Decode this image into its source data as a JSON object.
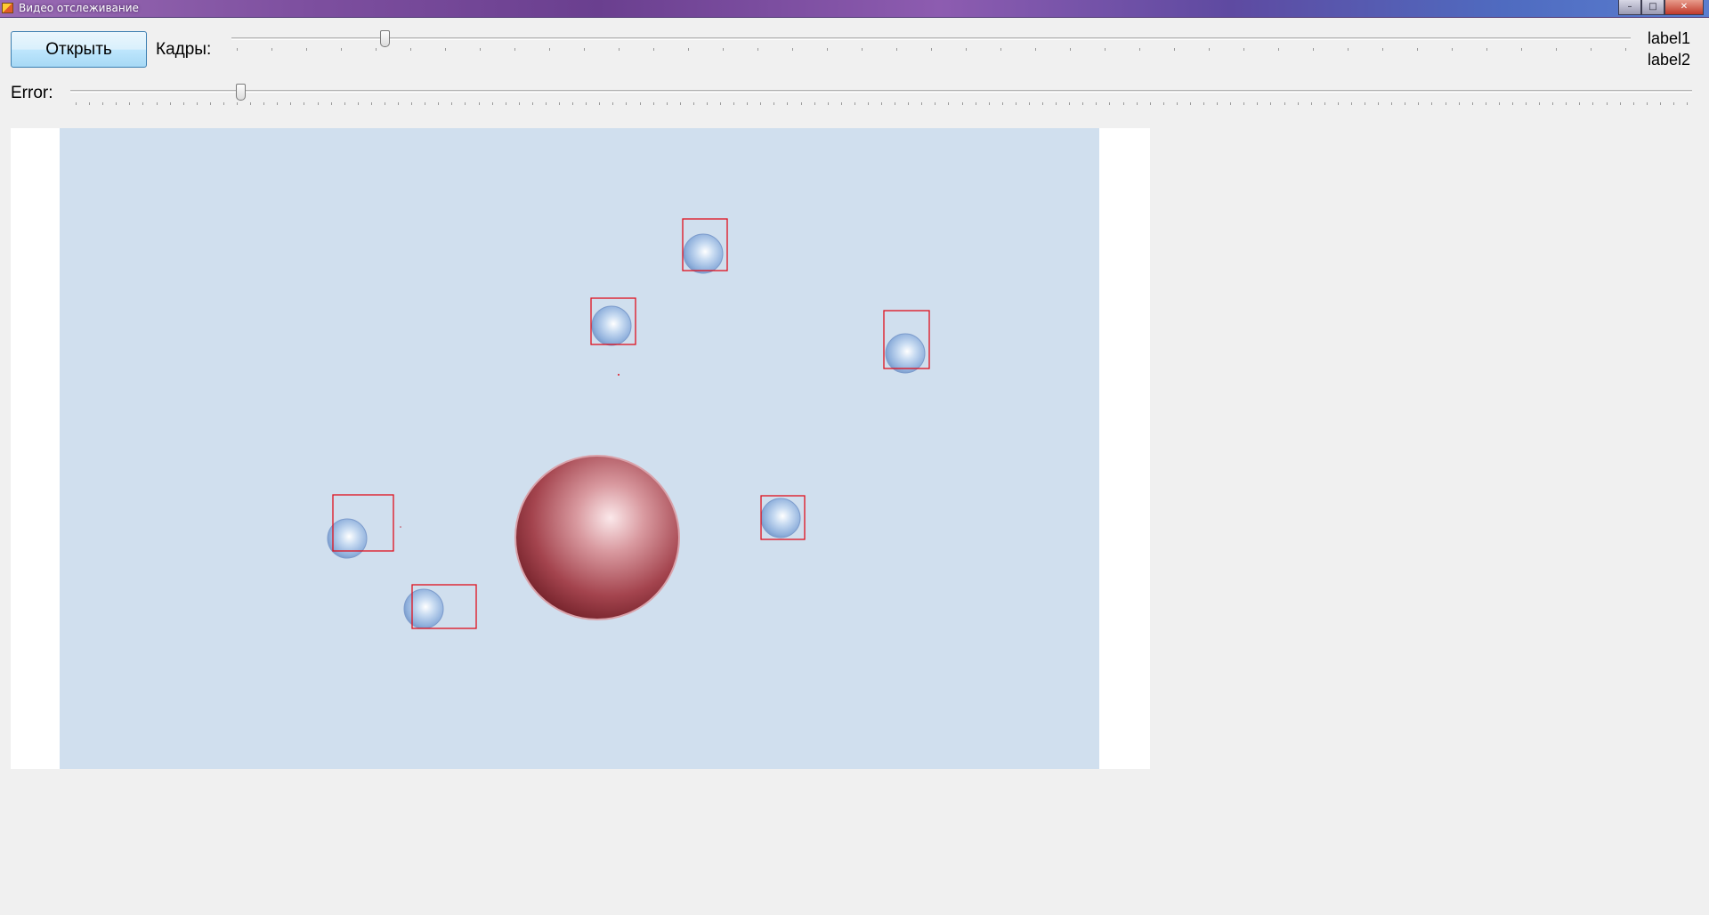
{
  "window": {
    "title": "Видео отслеживание",
    "buttons": {
      "minimize": "–",
      "maximize": "□",
      "close": "✕"
    }
  },
  "toolbar": {
    "open_button": "Открыть",
    "frames_label": "Кадры:",
    "error_label": "Error:",
    "label1": "label1",
    "label2": "label2"
  },
  "sliders": {
    "frames_value_fraction": 0.107,
    "error_value_fraction": 0.103
  },
  "icons": {
    "app": "app-icon"
  },
  "colors": {
    "video_background": "#d0dfee",
    "detection_box": "#e0101c",
    "small_ball": "#9bbbe2",
    "large_ball": "#9a3a42"
  }
}
